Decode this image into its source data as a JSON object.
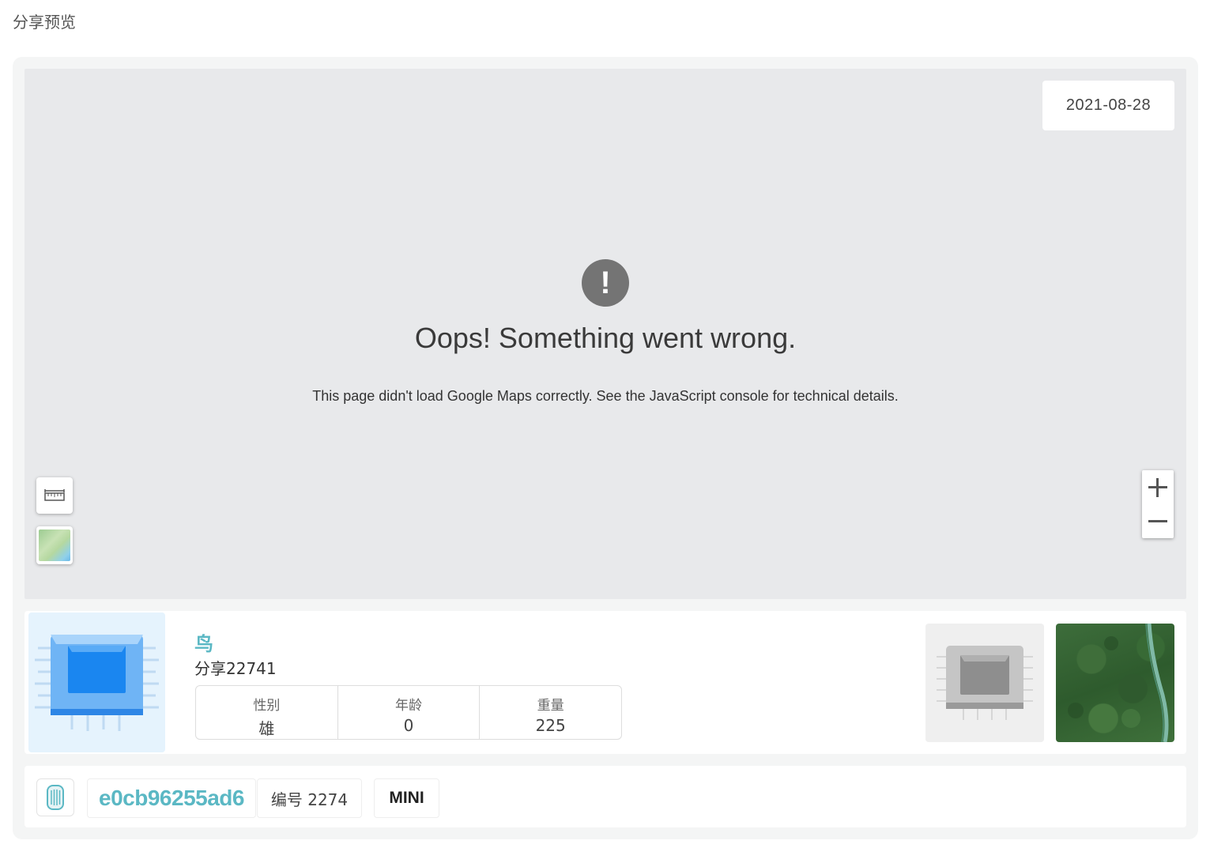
{
  "page": {
    "title": "分享预览"
  },
  "map": {
    "date": "2021-08-28",
    "error_title": "Oops! Something went wrong.",
    "error_detail": "This page didn't load Google Maps correctly. See the JavaScript console for technical details.",
    "error_icon": "exclamation-icon",
    "controls": {
      "zoom_in_icon": "plus-icon",
      "zoom_out_icon": "minus-icon",
      "ruler_icon": "ruler-icon",
      "maptype_icon": "map-thumbnail"
    }
  },
  "animal": {
    "species": "鸟",
    "name": "分享22741",
    "stats": [
      {
        "label": "性别",
        "value": "雄"
      },
      {
        "label": "年龄",
        "value": "0"
      },
      {
        "label": "重量",
        "value": "225"
      }
    ]
  },
  "device": {
    "id": "e0cb96255ad6",
    "number": "编号 2274",
    "model": "MINI",
    "icon": "device-icon"
  },
  "colors": {
    "accent": "#5bb8c4",
    "map_bg": "#e8e9eb",
    "chip_blue": "#1a86f0"
  }
}
